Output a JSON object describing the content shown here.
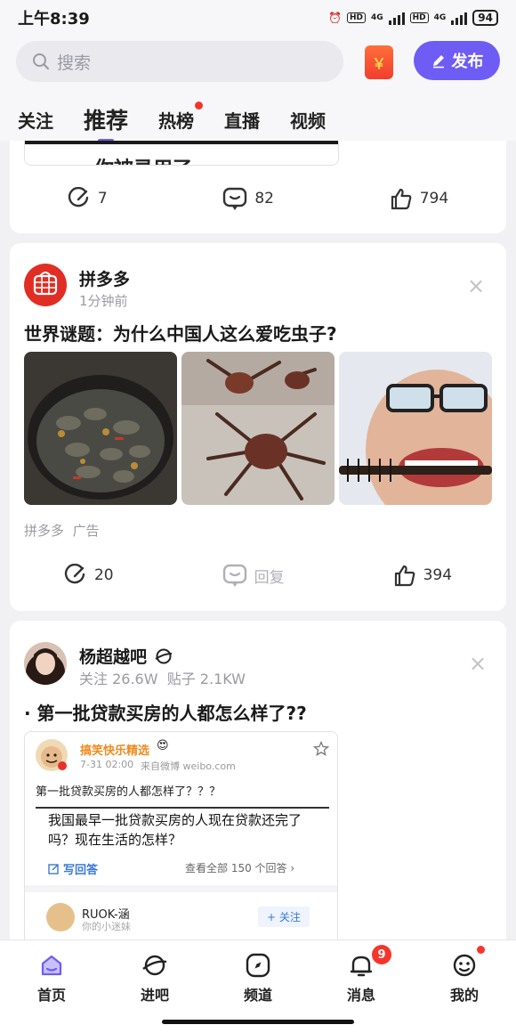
{
  "status": {
    "time": "上午8:39",
    "net1": "4G",
    "net2": "4G",
    "hd": "HD",
    "battery": "94"
  },
  "search": {
    "placeholder": "搜索"
  },
  "header": {
    "redpack_icon": "￥",
    "publish_label": "发布"
  },
  "tabs": [
    {
      "label": "关注"
    },
    {
      "label": "推荐"
    },
    {
      "label": "热榜"
    },
    {
      "label": "直播"
    },
    {
      "label": "视频"
    }
  ],
  "post0": {
    "snippet": "你被录用了",
    "share_count": "7",
    "comment_count": "82",
    "like_count": "794"
  },
  "post1": {
    "author": "拼多多",
    "time": "1分钟前",
    "title": "世界谜题：为什么中国人这么爱吃虫子?",
    "ad_source": "拼多多",
    "ad_label": "广告",
    "share_count": "20",
    "reply_label": "回复",
    "like_count": "394",
    "close_icon": "×"
  },
  "post2": {
    "author": "杨超越吧",
    "follow_stat": "关注 26.6W",
    "post_stat": "贴子 2.1KW",
    "title": "· 第一批贷款买房的人都怎么样了??",
    "close_icon": "×",
    "embed": {
      "account": "搞笑快乐精选",
      "date": "7-31 02:00",
      "source": "来自微博 weibo.com",
      "text": "第一批贷款买房的人都怎样了？？？",
      "question": "我国最早一批贷款买房的人现在贷款还完了吗？现在生活的怎样？",
      "write_answer": "写回答",
      "view_all": "查看全部 150 个回答",
      "answerer": "RUOK-涵",
      "answerer_sub": "你的小迷妹",
      "follow_btn": "+ 关注"
    }
  },
  "nav": [
    {
      "label": "首页"
    },
    {
      "label": "进吧"
    },
    {
      "label": "频道"
    },
    {
      "label": "消息",
      "badge": "9"
    },
    {
      "label": "我的"
    }
  ],
  "colors": {
    "accent": "#6e5cf5",
    "red": "#f5352b",
    "pdd_red": "#e02e24"
  }
}
